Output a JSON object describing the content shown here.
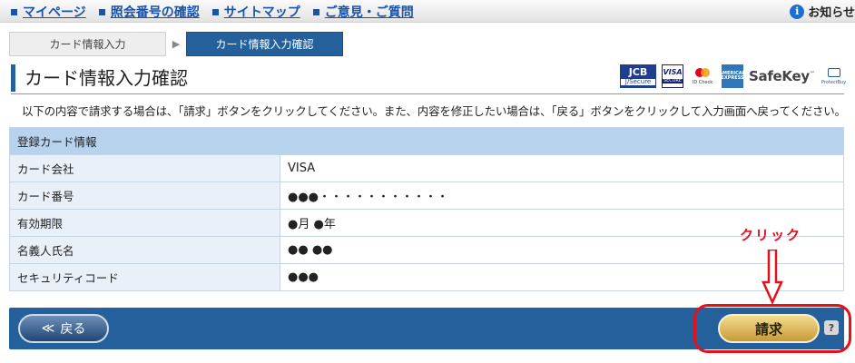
{
  "nav": {
    "links": [
      "マイページ",
      "照会番号の確認",
      "サイトマップ",
      "ご意見・ご質問"
    ],
    "notice": "お知らせ"
  },
  "steps": [
    "カード情報入力",
    "カード情報入力確認"
  ],
  "page_title": "カード情報入力確認",
  "brands": {
    "jcb": "JCB",
    "jcb_sub": "J/Secure",
    "visa": "VISA",
    "visa_sub": "SECURE",
    "mastercard_sub": "ID Check",
    "amex": "AMERICAN EXPRESS",
    "safekey": "SafeKey",
    "protectbuy": "ProtectBuy"
  },
  "instruction": "以下の内容で請求する場合は、「請求」ボタンをクリックしてください。また、内容を修正したい場合は、「戻る」ボタンをクリックして入力画面へ戻ってください。",
  "table": {
    "header": "登録カード情報",
    "rows": [
      {
        "label": "カード会社",
        "value": "VISA"
      },
      {
        "label": "カード番号",
        "value": "●●●・・・・・・・・・・・"
      },
      {
        "label": "有効期限",
        "value": "●月 ●年"
      },
      {
        "label": "名義人氏名",
        "value": "●● ●●"
      },
      {
        "label": "セキュリティコード",
        "value": "●●●"
      }
    ]
  },
  "buttons": {
    "back_icon": "≪",
    "back": "戻る",
    "submit": "請求",
    "help": "?"
  },
  "annotation": {
    "text": "クリック",
    "color": "#e4101a"
  },
  "colors": {
    "accent": "#24609b",
    "link": "#1b53a6",
    "table_header": "#b7d2ec",
    "submit_gold": "#c89a36"
  }
}
